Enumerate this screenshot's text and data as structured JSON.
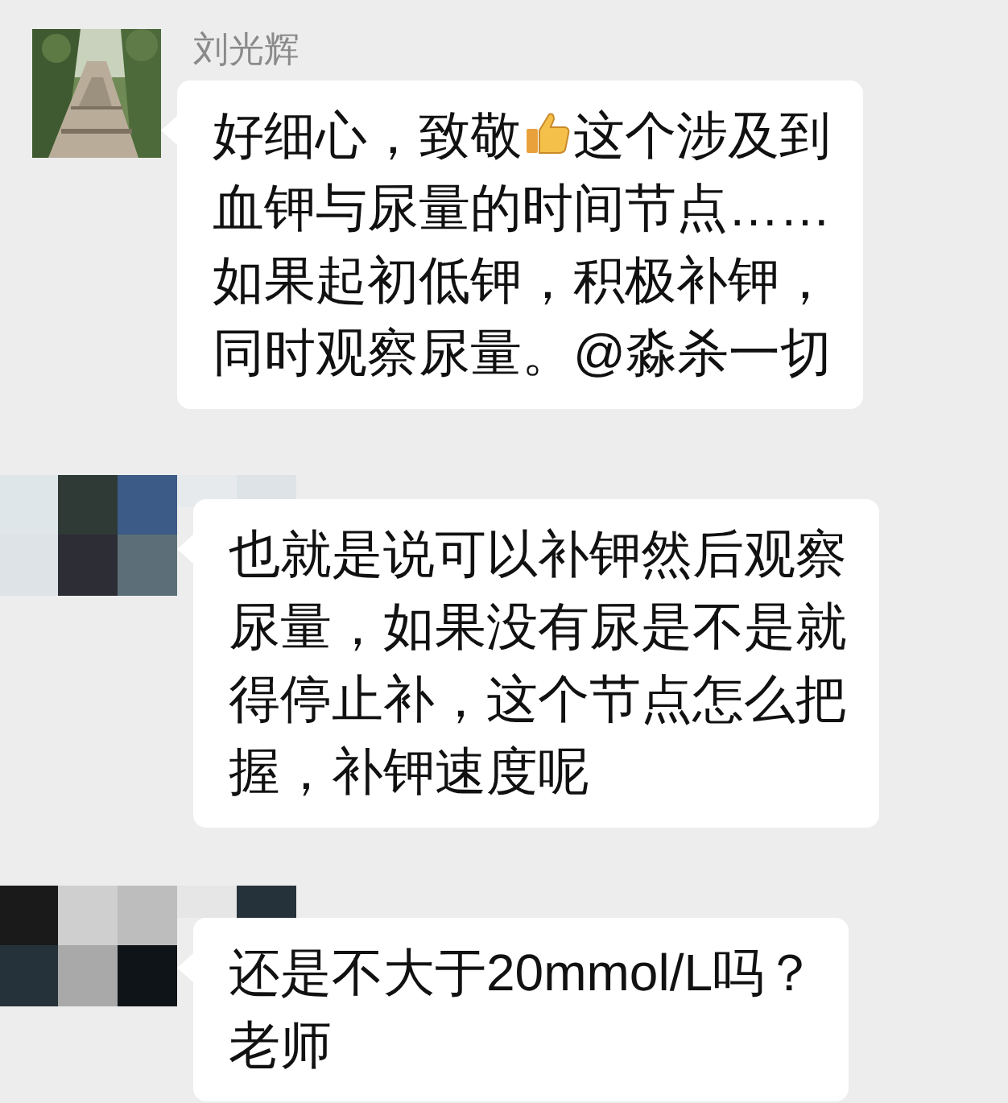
{
  "messages": [
    {
      "sender": "刘光辉",
      "avatar": {
        "kind": "picture"
      },
      "lines": [
        [
          {
            "kind": "text",
            "text": "好细心，致敬"
          },
          {
            "kind": "thumbs_up"
          },
          {
            "kind": "text",
            "text": "这个涉及到"
          }
        ],
        [
          {
            "kind": "text",
            "text": "血钾与尿量的时间节点……"
          }
        ],
        [
          {
            "kind": "text",
            "text": "如果起初低钾，积极补钾，"
          }
        ],
        [
          {
            "kind": "text",
            "text": "同时观察尿量。@淼杀一切"
          }
        ]
      ]
    },
    {
      "avatar": {
        "kind": "mosaic"
      },
      "lines": [
        [
          {
            "kind": "text",
            "text": "也就是说可以补钾然后观察"
          }
        ],
        [
          {
            "kind": "text",
            "text": "尿量，如果没有尿是不是就"
          }
        ],
        [
          {
            "kind": "text",
            "text": "得停止补，这个节点怎么把"
          }
        ],
        [
          {
            "kind": "text",
            "text": "握，补钾速度呢"
          }
        ]
      ]
    },
    {
      "avatar": {
        "kind": "mosaic"
      },
      "lines": [
        [
          {
            "kind": "text",
            "text": "还是不大于20mmol/L吗？"
          }
        ],
        [
          {
            "kind": "text",
            "text": "老师"
          }
        ]
      ]
    }
  ]
}
